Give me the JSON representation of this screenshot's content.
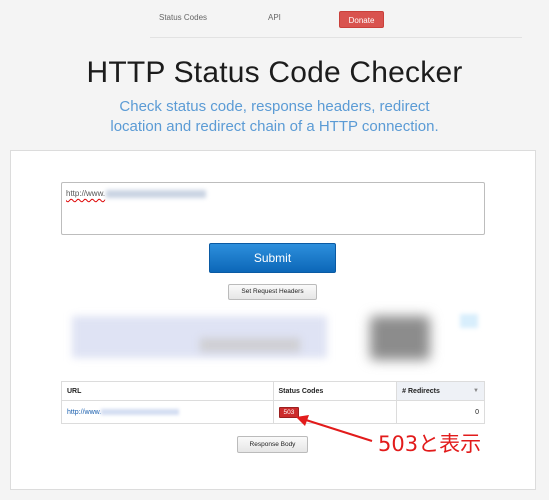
{
  "nav": {
    "status_codes": "Status Codes",
    "api": "API",
    "donate": "Donate"
  },
  "header": {
    "title": "HTTP Status Code Checker",
    "subtitle_line1": "Check status code, response headers, redirect",
    "subtitle_line2": "location and redirect chain of a HTTP connection."
  },
  "form": {
    "url_value": "http://www.",
    "submit_label": "Submit",
    "set_headers_label": "Set Request Headers"
  },
  "table": {
    "columns": [
      "URL",
      "Status Codes",
      "# Redirects"
    ],
    "rows": [
      {
        "url": "http://www.",
        "status": "503",
        "redirects": "0"
      }
    ]
  },
  "response_body_label": "Response Body",
  "annotation": {
    "text": "503と表示"
  },
  "colors": {
    "accent": "#5b9bd5",
    "submit": "#1576c8",
    "donate": "#d9534f",
    "status_error": "#cc2c2c",
    "annotation": "#e21b1b"
  }
}
